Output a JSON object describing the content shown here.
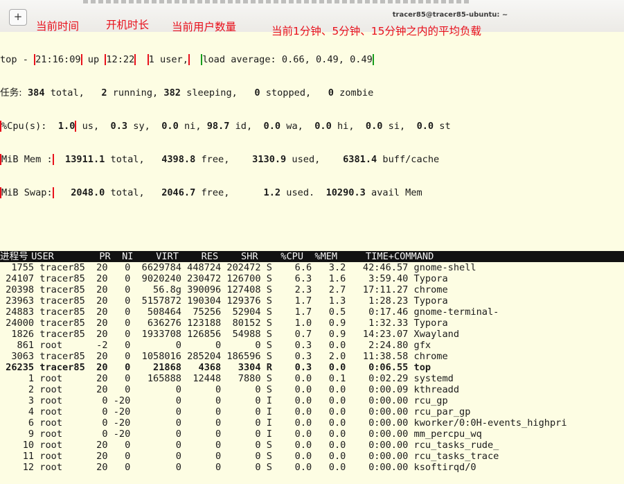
{
  "window": {
    "title": "tracer85@tracer85-ubuntu: ~",
    "new_tab_symbol": "+"
  },
  "annotations": {
    "current_time": "当前时间",
    "uptime": "开机时长",
    "user_count": "当前用户数量",
    "load_average": "当前1分钟、5分钟、15分钟之内的平均负载"
  },
  "summary": {
    "top_prefix": "top -",
    "time": "21:16:09",
    "up_word": "up",
    "uptime": "12:22",
    "users": "1 user,",
    "load_average": "load average: 0.66, 0.49, 0.49",
    "tasks_label": "任务:",
    "tasks_total": "384",
    "tasks_rest_1": " total,   ",
    "tasks_running": "2",
    "tasks_rest_2": " running, ",
    "tasks_sleeping": "382",
    "tasks_rest_3": " sleeping,   ",
    "tasks_stopped": "0",
    "tasks_rest_4": " stopped,   ",
    "tasks_zombie": "0",
    "tasks_rest_5": " zombie",
    "cpu_label": "%Cpu(s):",
    "cpu_us": "1.0",
    "cpu_rest_1": " us,  ",
    "cpu_sy": "0.3",
    "cpu_rest_2": " sy,  ",
    "cpu_ni": "0.0",
    "cpu_rest_3": " ni, ",
    "cpu_id": "98.7",
    "cpu_rest_4": " id,  ",
    "cpu_wa": "0.0",
    "cpu_rest_5": " wa,  ",
    "cpu_hi": "0.0",
    "cpu_rest_6": " hi,  ",
    "cpu_si": "0.0",
    "cpu_rest_7": " si,  ",
    "cpu_st": "0.0",
    "cpu_rest_8": " st",
    "mem_label": "MiB Mem :",
    "mem_total": "13911.1",
    "mem_rest_1": " total,   ",
    "mem_free": "4398.8",
    "mem_rest_2": " free,    ",
    "mem_used": "3130.9",
    "mem_rest_3": " used,    ",
    "mem_buff": "6381.4",
    "mem_rest_4": " buff/cache",
    "swap_label": "MiB Swap:",
    "swap_total": "2048.0",
    "swap_rest_1": " total,   ",
    "swap_free": "2046.7",
    "swap_rest_2": " free,      ",
    "swap_used": "1.2",
    "swap_rest_3": " used.  ",
    "swap_avail": "10290.3",
    "swap_rest_4": " avail Mem"
  },
  "process_table": {
    "headers": [
      {
        "text": "进程号",
        "width": 4
      },
      {
        "text": "USER",
        "width": 9
      },
      {
        "text": "PR",
        "width": 4
      },
      {
        "text": "NI",
        "width": 4
      },
      {
        "text": "VIRT",
        "width": 8
      },
      {
        "text": "RES",
        "width": 7
      },
      {
        "text": "SHR",
        "width": 7
      },
      {
        "text": "",
        "width": 2
      },
      {
        "text": "%CPU",
        "width": 6
      },
      {
        "text": "%MEM",
        "width": 6
      },
      {
        "text": "TIME+",
        "width": 10
      },
      {
        "text": "COMMAND",
        "width": 0
      }
    ],
    "rows": [
      {
        "pid": "1755",
        "user": "tracer85",
        "pr": "20",
        "ni": "0",
        "virt": "6629784",
        "res": "448724",
        "shr": "202472",
        "s": "S",
        "cpu": "6.6",
        "mem": "3.2",
        "time": "42:46.57",
        "command": "gnome-shell",
        "bold": false
      },
      {
        "pid": "24107",
        "user": "tracer85",
        "pr": "20",
        "ni": "0",
        "virt": "9020240",
        "res": "230472",
        "shr": "126700",
        "s": "S",
        "cpu": "6.3",
        "mem": "1.6",
        "time": "3:59.40",
        "command": "Typora",
        "bold": false
      },
      {
        "pid": "20398",
        "user": "tracer85",
        "pr": "20",
        "ni": "0",
        "virt": "56.8g",
        "res": "390096",
        "shr": "127408",
        "s": "S",
        "cpu": "2.3",
        "mem": "2.7",
        "time": "17:11.27",
        "command": "chrome",
        "bold": false
      },
      {
        "pid": "23963",
        "user": "tracer85",
        "pr": "20",
        "ni": "0",
        "virt": "5157872",
        "res": "190304",
        "shr": "129376",
        "s": "S",
        "cpu": "1.7",
        "mem": "1.3",
        "time": "1:28.23",
        "command": "Typora",
        "bold": false
      },
      {
        "pid": "24883",
        "user": "tracer85",
        "pr": "20",
        "ni": "0",
        "virt": "508464",
        "res": "75256",
        "shr": "52904",
        "s": "S",
        "cpu": "1.7",
        "mem": "0.5",
        "time": "0:17.46",
        "command": "gnome-terminal-",
        "bold": false
      },
      {
        "pid": "24000",
        "user": "tracer85",
        "pr": "20",
        "ni": "0",
        "virt": "636276",
        "res": "123188",
        "shr": "80152",
        "s": "S",
        "cpu": "1.0",
        "mem": "0.9",
        "time": "1:32.33",
        "command": "Typora",
        "bold": false
      },
      {
        "pid": "1826",
        "user": "tracer85",
        "pr": "20",
        "ni": "0",
        "virt": "1933708",
        "res": "126856",
        "shr": "54988",
        "s": "S",
        "cpu": "0.7",
        "mem": "0.9",
        "time": "14:23.07",
        "command": "Xwayland",
        "bold": false
      },
      {
        "pid": "861",
        "user": "root",
        "pr": "-2",
        "ni": "0",
        "virt": "0",
        "res": "0",
        "shr": "0",
        "s": "S",
        "cpu": "0.3",
        "mem": "0.0",
        "time": "2:24.80",
        "command": "gfx",
        "bold": false
      },
      {
        "pid": "3063",
        "user": "tracer85",
        "pr": "20",
        "ni": "0",
        "virt": "1058016",
        "res": "285204",
        "shr": "186596",
        "s": "S",
        "cpu": "0.3",
        "mem": "2.0",
        "time": "11:38.58",
        "command": "chrome",
        "bold": false
      },
      {
        "pid": "26235",
        "user": "tracer85",
        "pr": "20",
        "ni": "0",
        "virt": "21868",
        "res": "4368",
        "shr": "3304",
        "s": "R",
        "cpu": "0.3",
        "mem": "0.0",
        "time": "0:06.55",
        "command": "top",
        "bold": true
      },
      {
        "pid": "1",
        "user": "root",
        "pr": "20",
        "ni": "0",
        "virt": "165888",
        "res": "12448",
        "shr": "7880",
        "s": "S",
        "cpu": "0.0",
        "mem": "0.1",
        "time": "0:02.29",
        "command": "systemd",
        "bold": false
      },
      {
        "pid": "2",
        "user": "root",
        "pr": "20",
        "ni": "0",
        "virt": "0",
        "res": "0",
        "shr": "0",
        "s": "S",
        "cpu": "0.0",
        "mem": "0.0",
        "time": "0:00.09",
        "command": "kthreadd",
        "bold": false
      },
      {
        "pid": "3",
        "user": "root",
        "pr": "0",
        "ni": "-20",
        "virt": "0",
        "res": "0",
        "shr": "0",
        "s": "I",
        "cpu": "0.0",
        "mem": "0.0",
        "time": "0:00.00",
        "command": "rcu_gp",
        "bold": false
      },
      {
        "pid": "4",
        "user": "root",
        "pr": "0",
        "ni": "-20",
        "virt": "0",
        "res": "0",
        "shr": "0",
        "s": "I",
        "cpu": "0.0",
        "mem": "0.0",
        "time": "0:00.00",
        "command": "rcu_par_gp",
        "bold": false
      },
      {
        "pid": "6",
        "user": "root",
        "pr": "0",
        "ni": "-20",
        "virt": "0",
        "res": "0",
        "shr": "0",
        "s": "I",
        "cpu": "0.0",
        "mem": "0.0",
        "time": "0:00.00",
        "command": "kworker/0:0H-events_highpri",
        "bold": false
      },
      {
        "pid": "9",
        "user": "root",
        "pr": "0",
        "ni": "-20",
        "virt": "0",
        "res": "0",
        "shr": "0",
        "s": "I",
        "cpu": "0.0",
        "mem": "0.0",
        "time": "0:00.00",
        "command": "mm_percpu_wq",
        "bold": false
      },
      {
        "pid": "10",
        "user": "root",
        "pr": "20",
        "ni": "0",
        "virt": "0",
        "res": "0",
        "shr": "0",
        "s": "S",
        "cpu": "0.0",
        "mem": "0.0",
        "time": "0:00.00",
        "command": "rcu_tasks_rude_",
        "bold": false
      },
      {
        "pid": "11",
        "user": "root",
        "pr": "20",
        "ni": "0",
        "virt": "0",
        "res": "0",
        "shr": "0",
        "s": "S",
        "cpu": "0.0",
        "mem": "0.0",
        "time": "0:00.00",
        "command": "rcu_tasks_trace",
        "bold": false
      },
      {
        "pid": "12",
        "user": "root",
        "pr": "20",
        "ni": "0",
        "virt": "0",
        "res": "0",
        "shr": "0",
        "s": "S",
        "cpu": "0.0",
        "mem": "0.0",
        "time": "0:00.00",
        "command": "ksoftirqd/0",
        "bold": false
      }
    ]
  },
  "colors": {
    "terminal_bg": "#fdfde3",
    "annotation_red": "#e8101b",
    "annotation_green": "#169c1b",
    "header_bar_bg": "#121212"
  }
}
